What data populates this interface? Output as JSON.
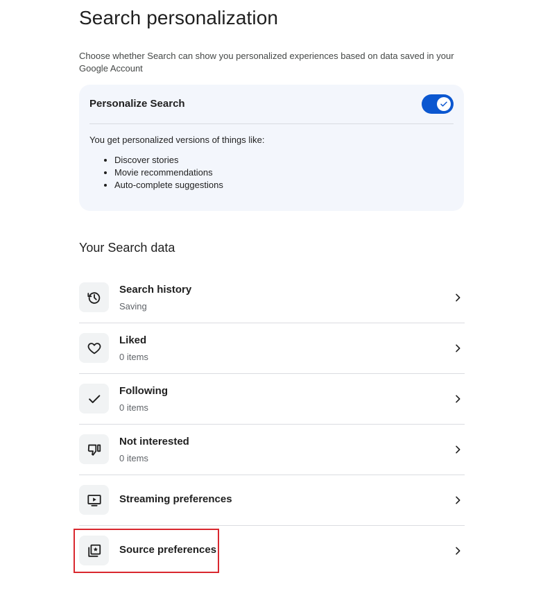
{
  "page": {
    "title": "Search personalization",
    "description": "Choose whether Search can show you personalized experiences based on data saved in your Google Account"
  },
  "personalize_card": {
    "title": "Personalize Search",
    "toggle_on": true,
    "intro": "You get personalized versions of things like:",
    "examples": [
      "Discover stories",
      "Movie recommendations",
      "Auto-complete suggestions"
    ]
  },
  "search_data": {
    "title": "Your Search data",
    "items": [
      {
        "title": "Search history",
        "subtitle": "Saving",
        "icon": "history-icon"
      },
      {
        "title": "Liked",
        "subtitle": "0 items",
        "icon": "heart-icon"
      },
      {
        "title": "Following",
        "subtitle": "0 items",
        "icon": "checkmark-icon"
      },
      {
        "title": "Not interested",
        "subtitle": "0 items",
        "icon": "thumbs-down-icon"
      },
      {
        "title": "Streaming preferences",
        "subtitle": "",
        "icon": "play-screen-icon"
      },
      {
        "title": "Source preferences",
        "subtitle": "",
        "icon": "source-star-icon"
      }
    ]
  },
  "colors": {
    "toggle_accent": "#0b57d0",
    "card_background": "#f3f6fc",
    "highlight_border": "#d9272e"
  }
}
